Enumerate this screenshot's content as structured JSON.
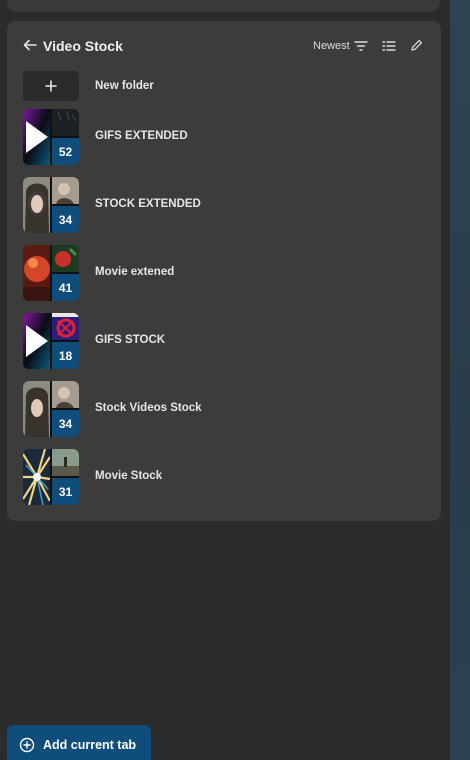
{
  "panel": {
    "title": "Video Stock",
    "sort_label": "Newest",
    "icons": {
      "back": "arrow-left-icon",
      "sort": "sort-filter-icon",
      "view": "list-view-icon",
      "edit": "pencil-icon"
    }
  },
  "new_folder": {
    "label": "New folder",
    "icon": "plus-icon"
  },
  "folders": [
    {
      "label": "GIFS EXTENDED",
      "count": "52",
      "thumb": "play-gif"
    },
    {
      "label": "STOCK EXTENDED",
      "count": "34",
      "thumb": "portrait"
    },
    {
      "label": "Movie extened",
      "count": "41",
      "thumb": "red-orange"
    },
    {
      "label": "GIFS STOCK",
      "count": "18",
      "thumb": "play-gif-2"
    },
    {
      "label": "Stock Videos Stock",
      "count": "34",
      "thumb": "portrait"
    },
    {
      "label": "Movie Stock",
      "count": "31",
      "thumb": "light-burst"
    }
  ],
  "footer": {
    "add_tab_label": "Add current tab",
    "icon": "plus-circle-icon"
  },
  "colors": {
    "accent": "#0f4d7d",
    "panel": "#3c3c3c",
    "background": "#2b2b2b"
  }
}
